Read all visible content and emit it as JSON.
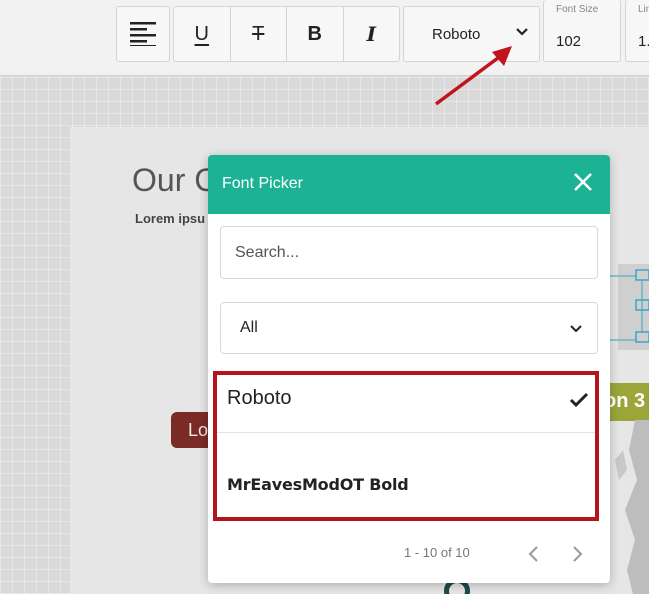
{
  "toolbar": {
    "align_icon": "align-left-icon",
    "underline_label": "U",
    "strikethrough_label": "T",
    "bold_label": "B",
    "italic_label": "I",
    "font_family_value": "Roboto",
    "font_size": {
      "label": "Font Size",
      "value": "102"
    },
    "line_field": {
      "label": "Lin",
      "value": "1."
    }
  },
  "canvas": {
    "title": "Our C",
    "lorem": "Lorem ipsu",
    "button_text": "Lo",
    "tag_text": "on 3"
  },
  "font_picker": {
    "title": "Font Picker",
    "search_placeholder": "Search...",
    "category_value": "All",
    "items": [
      {
        "label": "Roboto",
        "selected": true
      },
      {
        "label": "MrEavesModOT Bold",
        "selected": false
      }
    ],
    "pagination": "1 - 10 of 10"
  },
  "colors": {
    "header": "#1cb394",
    "highlight_border": "#b3151b",
    "arrow": "#c0151b"
  }
}
